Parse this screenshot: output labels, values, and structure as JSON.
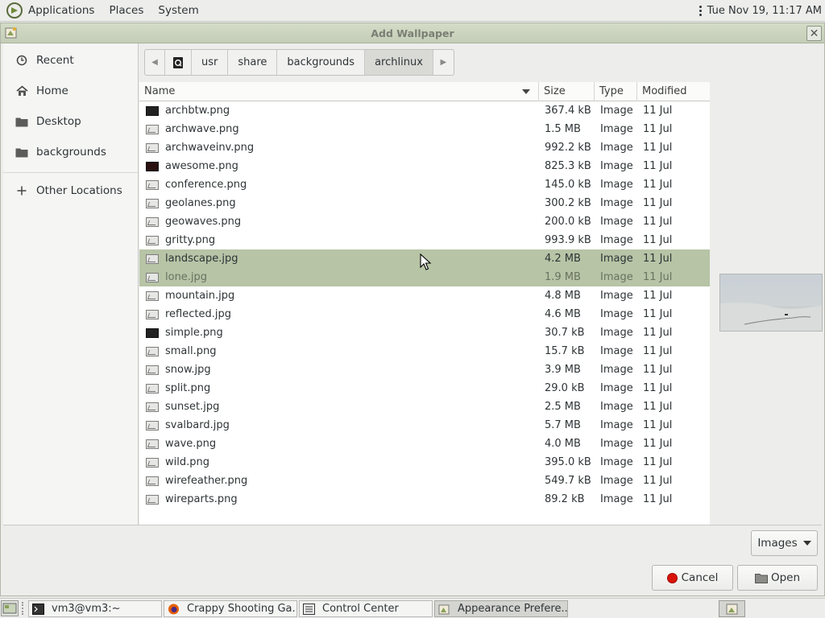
{
  "top_panel": {
    "menus": [
      "Applications",
      "Places",
      "System"
    ],
    "clock": "Tue Nov 19, 11:17 AM"
  },
  "dialog": {
    "title": "Add Wallpaper",
    "sidebar": [
      {
        "label": "Recent",
        "icon": "clock-icon"
      },
      {
        "label": "Home",
        "icon": "home-icon"
      },
      {
        "label": "Desktop",
        "icon": "folder-icon"
      },
      {
        "label": "backgrounds",
        "icon": "folder-icon"
      },
      {
        "label": "Other Locations",
        "icon": "plus-icon"
      }
    ],
    "pathbar": [
      "usr",
      "share",
      "backgrounds",
      "archlinux"
    ],
    "columns": {
      "name": "Name",
      "size": "Size",
      "type": "Type",
      "modified": "Modified"
    },
    "files": [
      {
        "name": "archbtw.png",
        "size": "367.4 kB",
        "type": "Image",
        "modified": "11 Jul",
        "thumb": "dark"
      },
      {
        "name": "archwave.png",
        "size": "1.5 MB",
        "type": "Image",
        "modified": "11 Jul",
        "thumb": "image"
      },
      {
        "name": "archwaveinv.png",
        "size": "992.2 kB",
        "type": "Image",
        "modified": "11 Jul",
        "thumb": "image"
      },
      {
        "name": "awesome.png",
        "size": "825.3 kB",
        "type": "Image",
        "modified": "11 Jul",
        "thumb": "dark-red"
      },
      {
        "name": "conference.png",
        "size": "145.0 kB",
        "type": "Image",
        "modified": "11 Jul",
        "thumb": "image"
      },
      {
        "name": "geolanes.png",
        "size": "300.2 kB",
        "type": "Image",
        "modified": "11 Jul",
        "thumb": "image"
      },
      {
        "name": "geowaves.png",
        "size": "200.0 kB",
        "type": "Image",
        "modified": "11 Jul",
        "thumb": "image"
      },
      {
        "name": "gritty.png",
        "size": "993.9 kB",
        "type": "Image",
        "modified": "11 Jul",
        "thumb": "image"
      },
      {
        "name": "landscape.jpg",
        "size": "4.2 MB",
        "type": "Image",
        "modified": "11 Jul",
        "thumb": "image",
        "selected": true
      },
      {
        "name": "lone.jpg",
        "size": "1.9 MB",
        "type": "Image",
        "modified": "11 Jul",
        "thumb": "image",
        "selected": true
      },
      {
        "name": "mountain.jpg",
        "size": "4.8 MB",
        "type": "Image",
        "modified": "11 Jul",
        "thumb": "image"
      },
      {
        "name": "reflected.jpg",
        "size": "4.6 MB",
        "type": "Image",
        "modified": "11 Jul",
        "thumb": "image"
      },
      {
        "name": "simple.png",
        "size": "30.7 kB",
        "type": "Image",
        "modified": "11 Jul",
        "thumb": "dark"
      },
      {
        "name": "small.png",
        "size": "15.7 kB",
        "type": "Image",
        "modified": "11 Jul",
        "thumb": "image"
      },
      {
        "name": "snow.jpg",
        "size": "3.9 MB",
        "type": "Image",
        "modified": "11 Jul",
        "thumb": "image"
      },
      {
        "name": "split.png",
        "size": "29.0 kB",
        "type": "Image",
        "modified": "11 Jul",
        "thumb": "image"
      },
      {
        "name": "sunset.jpg",
        "size": "2.5 MB",
        "type": "Image",
        "modified": "11 Jul",
        "thumb": "image"
      },
      {
        "name": "svalbard.jpg",
        "size": "5.7 MB",
        "type": "Image",
        "modified": "11 Jul",
        "thumb": "image"
      },
      {
        "name": "wave.png",
        "size": "4.0 MB",
        "type": "Image",
        "modified": "11 Jul",
        "thumb": "image"
      },
      {
        "name": "wild.png",
        "size": "395.0 kB",
        "type": "Image",
        "modified": "11 Jul",
        "thumb": "image"
      },
      {
        "name": "wirefeather.png",
        "size": "549.7 kB",
        "type": "Image",
        "modified": "11 Jul",
        "thumb": "image"
      },
      {
        "name": "wireparts.png",
        "size": "89.2 kB",
        "type": "Image",
        "modified": "11 Jul",
        "thumb": "image"
      }
    ],
    "filter_label": "Images",
    "cancel_label": "Cancel",
    "open_label": "Open"
  },
  "taskbar": {
    "tasks": [
      {
        "label": "vm3@vm3:~",
        "icon": "terminal-icon"
      },
      {
        "label": "Crappy Shooting Ga...",
        "icon": "firefox-icon"
      },
      {
        "label": "Control Center",
        "icon": "control-center-icon"
      },
      {
        "label": "Appearance Prefere...",
        "icon": "appearance-icon",
        "active": true
      }
    ]
  },
  "colors": {
    "selection": "#b7c4a6",
    "titlebar": "#c8d1bb",
    "cancel_red": "#d9130a"
  }
}
